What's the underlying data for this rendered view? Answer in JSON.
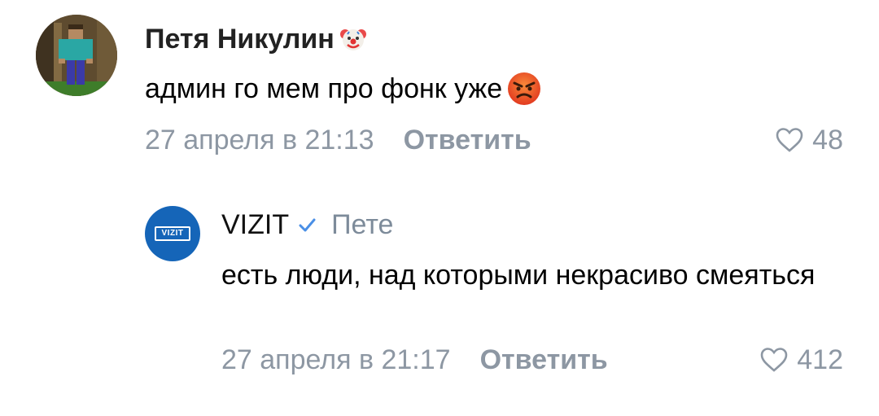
{
  "comments": [
    {
      "author": "Петя Никулин",
      "author_emoji": "clown-face",
      "text": "админ го мем про фонк уже",
      "text_emoji": "angry-face",
      "date": "27 апреля в 21:13",
      "reply_label": "Ответить",
      "likes": "48",
      "avatar": "minecraft-character-avatar"
    },
    {
      "author": "VIZIT",
      "verified": true,
      "reply_to": "Пете",
      "text": "есть люди, над которыми некрасиво смеяться",
      "date": "27 апреля в 21:17",
      "reply_label": "Ответить",
      "likes": "412",
      "avatar_logo": "VIZIT"
    }
  ],
  "colors": {
    "meta_gray": "#8d97a3",
    "reply_to_gray": "#7d8b9a",
    "verified_blue": "#4a8fe6",
    "vizit_blue": "#1565b8",
    "angry_orange": "#e8502a"
  }
}
